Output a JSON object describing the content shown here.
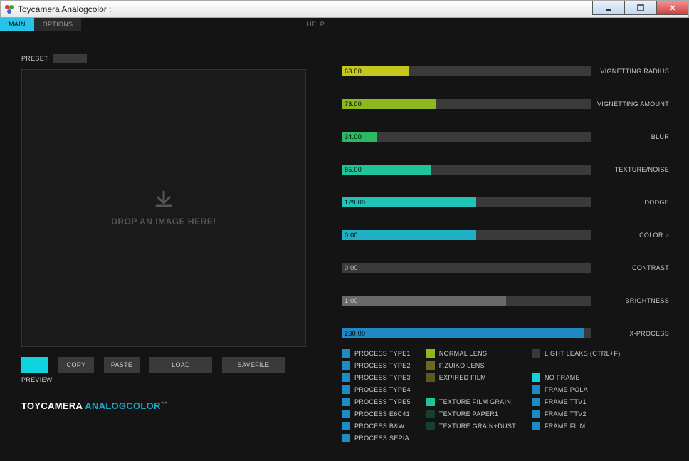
{
  "window": {
    "title": "Toycamera Analogcolor :"
  },
  "menu": {
    "main": "MAIN",
    "options": "OPTIONS",
    "help": "HELP"
  },
  "preset": {
    "label": "PRESET"
  },
  "drop": {
    "text": "DROP AN IMAGE HERE!"
  },
  "actions": {
    "preview": "PREVIEW",
    "copy": "COPY",
    "paste": "PASTE",
    "load": "LOAD",
    "savefile": "SAVEFILE"
  },
  "logo": {
    "part1": "TOYCAMERA ",
    "part2": "ANALOGCOLOR",
    "tm": "™"
  },
  "sliders": [
    {
      "value": "63.00",
      "pct": 27,
      "color": "#c4c81e",
      "label": "VIGNETTING RADIUS",
      "darkText": true
    },
    {
      "value": "73.00",
      "pct": 38,
      "color": "#8db81e",
      "label": "VIGNETTING AMOUNT",
      "darkText": true
    },
    {
      "value": "34.00",
      "pct": 14,
      "color": "#2db863",
      "label": "BLUR",
      "darkText": true
    },
    {
      "value": "85.00",
      "pct": 36,
      "color": "#1fc49a",
      "label": "TEXTURE/NOISE",
      "darkText": true
    },
    {
      "value": "129.00",
      "pct": 54,
      "color": "#1fc4b6",
      "label": "DODGE",
      "darkText": true
    },
    {
      "value": "0.00",
      "pct": 54,
      "color": "#1fb0c4",
      "label": "COLOR",
      "darkText": true,
      "arrow": true
    },
    {
      "value": "0.00",
      "pct": 0,
      "color": "#3a3a3a",
      "label": "CONTRAST",
      "darkText": false
    },
    {
      "value": "1.00",
      "pct": 66,
      "color": "#6a6a6a",
      "label": "BRIGHTNESS",
      "darkText": false
    },
    {
      "value": "230.00",
      "pct": 97,
      "color": "#1f8ac4",
      "label": "X-PROCESS",
      "darkText": true
    }
  ],
  "processCol": [
    {
      "color": "#1f8ac4",
      "label": "PROCESS TYPE1"
    },
    {
      "color": "#1f8ac4",
      "label": "PROCESS TYPE2"
    },
    {
      "color": "#1f8ac4",
      "label": "PROCESS TYPE3"
    },
    {
      "color": "#1f8ac4",
      "label": "PROCESS TYPE4"
    },
    {
      "color": "#1f8ac4",
      "label": "PROCESS TYPE5"
    },
    {
      "color": "#1f8ac4",
      "label": "PROCESS E6C41"
    },
    {
      "color": "#1f8ac4",
      "label": "PROCESS B&W"
    },
    {
      "color": "#1f8ac4",
      "label": "PROCESS SEPIA"
    }
  ],
  "lensCol": [
    {
      "color": "#8db81e",
      "label": "NORMAL LENS"
    },
    {
      "color": "#6a6a20",
      "label": "F.ZUIKO LENS"
    },
    {
      "color": "#5a5a20",
      "label": "EXPIRED FILM"
    },
    {
      "color": "",
      "label": ""
    },
    {
      "color": "#1fc49a",
      "label": "TEXTURE FILM GRAIN"
    },
    {
      "color": "#154030",
      "label": "TEXTURE PAPER1"
    },
    {
      "color": "#154030",
      "label": "TEXTURE GRAIN+DUST"
    }
  ],
  "lightLeak": {
    "label": "LIGHT LEAKS (CTRL+F)"
  },
  "frameCol": [
    {
      "color": "#0fd4e0",
      "label": "NO FRAME"
    },
    {
      "color": "#1f8ac4",
      "label": "FRAME POLA"
    },
    {
      "color": "#1f8ac4",
      "label": "FRAME TTV1"
    },
    {
      "color": "#1f8ac4",
      "label": "FRAME TTV2"
    },
    {
      "color": "#1f8ac4",
      "label": "FRAME FILM"
    }
  ]
}
